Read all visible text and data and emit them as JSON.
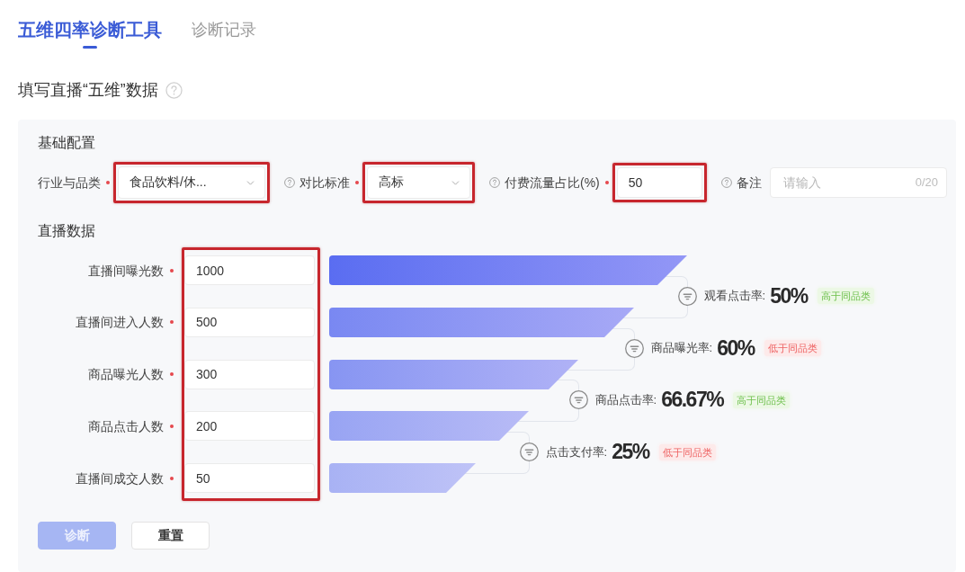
{
  "tabs": [
    {
      "label": "五维四率诊断工具",
      "selected": true
    },
    {
      "label": "诊断记录",
      "selected": false
    }
  ],
  "heading": {
    "title": "填写直播“五维”数据",
    "help": true
  },
  "basic_config": {
    "title": "基础配置",
    "fields": [
      {
        "kind": "select",
        "label": "行业与品类",
        "help": false,
        "required": true,
        "value": "食品饮料/休...",
        "highlighted": true
      },
      {
        "kind": "select",
        "label": "对比标准",
        "help": true,
        "required": true,
        "value": "高标",
        "highlighted": true
      },
      {
        "kind": "input",
        "label": "付费流量占比(%)",
        "help": true,
        "required": true,
        "value": "50",
        "highlighted": true
      },
      {
        "kind": "counter_input",
        "label": "备注",
        "help": true,
        "required": false,
        "placeholder": "请输入",
        "counter": "0/20",
        "highlighted": false
      }
    ]
  },
  "live_data": {
    "title": "直播数据",
    "highlighted": true,
    "fields": [
      {
        "label": "直播间曝光数",
        "required": true,
        "value": "1000"
      },
      {
        "label": "直播间进入人数",
        "required": true,
        "value": "500"
      },
      {
        "label": "商品曝光人数",
        "required": true,
        "value": "300"
      },
      {
        "label": "商品点击人数",
        "required": true,
        "value": "200"
      },
      {
        "label": "直播间成交人数",
        "required": true,
        "value": "50"
      }
    ],
    "rates": [
      {
        "label": "观看点击率:",
        "value": "50%",
        "tag": "高于同品类",
        "above_peers": true
      },
      {
        "label": "商品曝光率:",
        "value": "60%",
        "tag": "低于同品类",
        "above_peers": false
      },
      {
        "label": "商品点击率:",
        "value": "66.67%",
        "tag": "高于同品类",
        "above_peers": true
      },
      {
        "label": "点击支付率:",
        "value": "25%",
        "tag": "低于同品类",
        "above_peers": false
      }
    ]
  },
  "buttons": [
    {
      "label": "诊断",
      "kind": "primary",
      "disabled": true
    },
    {
      "label": "重置",
      "kind": "default",
      "disabled": false
    }
  ]
}
